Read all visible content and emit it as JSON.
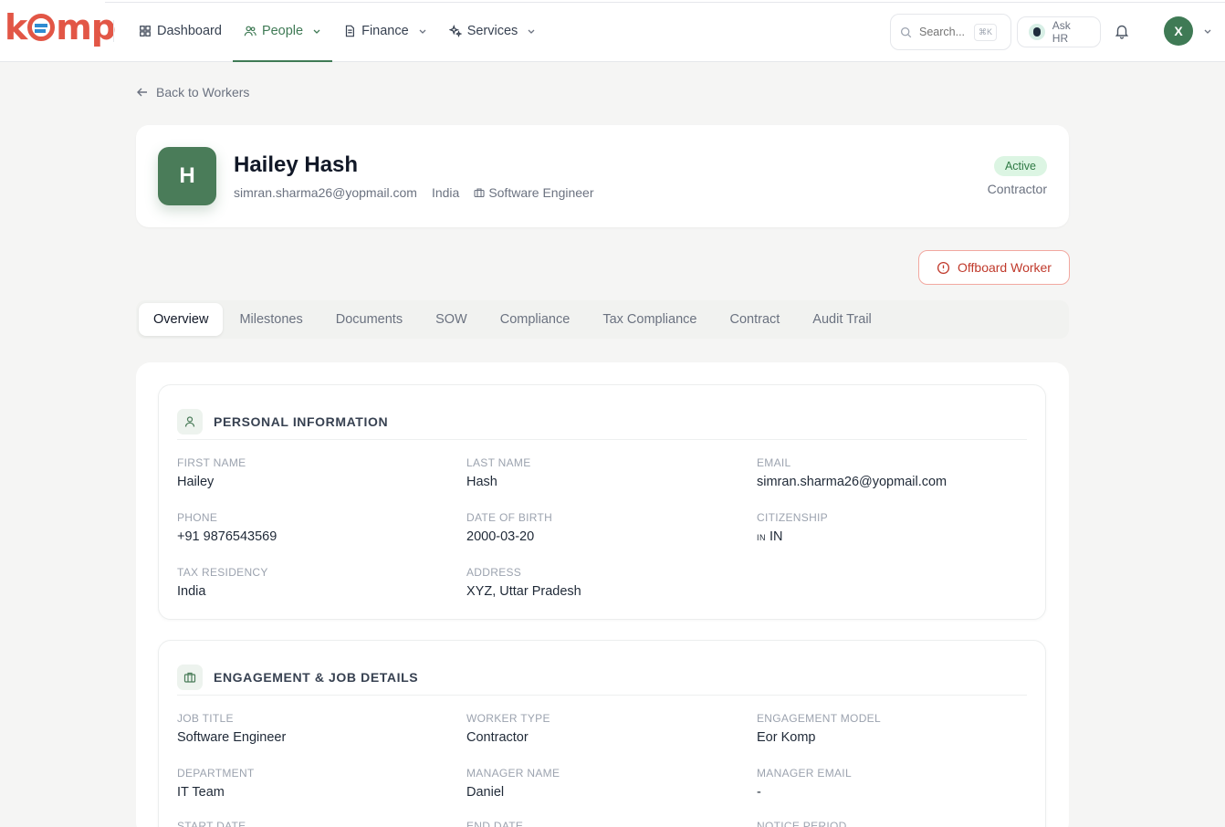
{
  "app": {
    "logo": "komp"
  },
  "nav": {
    "items": [
      {
        "label": "Dashboard",
        "icon": "grid-icon"
      },
      {
        "label": "People",
        "icon": "users-icon"
      },
      {
        "label": "Finance",
        "icon": "document-icon"
      },
      {
        "label": "Services",
        "icon": "sparkle-icon"
      }
    ],
    "active": "People"
  },
  "header": {
    "search_placeholder": "Search...",
    "shortcut": "⌘K",
    "ask_hr": "Ask HR",
    "user_initial": "X"
  },
  "back": {
    "label": "Back to Workers"
  },
  "profile": {
    "initial": "H",
    "name": "Hailey Hash",
    "email": "simran.sharma26@yopmail.com",
    "country": "India",
    "role": "Software Engineer",
    "status": "Active",
    "type": "Contractor"
  },
  "actions": {
    "offboard": "Offboard Worker"
  },
  "tabs": [
    "Overview",
    "Milestones",
    "Documents",
    "SOW",
    "Compliance",
    "Tax Compliance",
    "Contract",
    "Audit Trail"
  ],
  "personal": {
    "title": "PERSONAL INFORMATION",
    "first_name_label": "FIRST NAME",
    "first_name": "Hailey",
    "last_name_label": "LAST NAME",
    "last_name": "Hash",
    "email_label": "EMAIL",
    "email": "simran.sharma26@yopmail.com",
    "phone_label": "PHONE",
    "phone": "+91 9876543569",
    "dob_label": "DATE OF BIRTH",
    "dob": "2000-03-20",
    "citizenship_label": "CITIZENSHIP",
    "citizenship_flag": "IN",
    "citizenship": "IN",
    "tax_label": "TAX RESIDENCY",
    "tax": "India",
    "address_label": "ADDRESS",
    "address": "XYZ, Uttar Pradesh"
  },
  "engagement": {
    "title": "ENGAGEMENT & JOB DETAILS",
    "job_title_label": "JOB TITLE",
    "job_title": "Software Engineer",
    "worker_type_label": "WORKER TYPE",
    "worker_type": "Contractor",
    "model_label": "ENGAGEMENT MODEL",
    "model": "Eor Komp",
    "department_label": "DEPARTMENT",
    "department": "IT Team",
    "manager_name_label": "MANAGER NAME",
    "manager_name": "Daniel",
    "manager_email_label": "MANAGER EMAIL",
    "manager_email": "-",
    "start_date_label": "START DATE",
    "end_date_label": "END DATE",
    "notice_label": "NOTICE PERIOD"
  }
}
